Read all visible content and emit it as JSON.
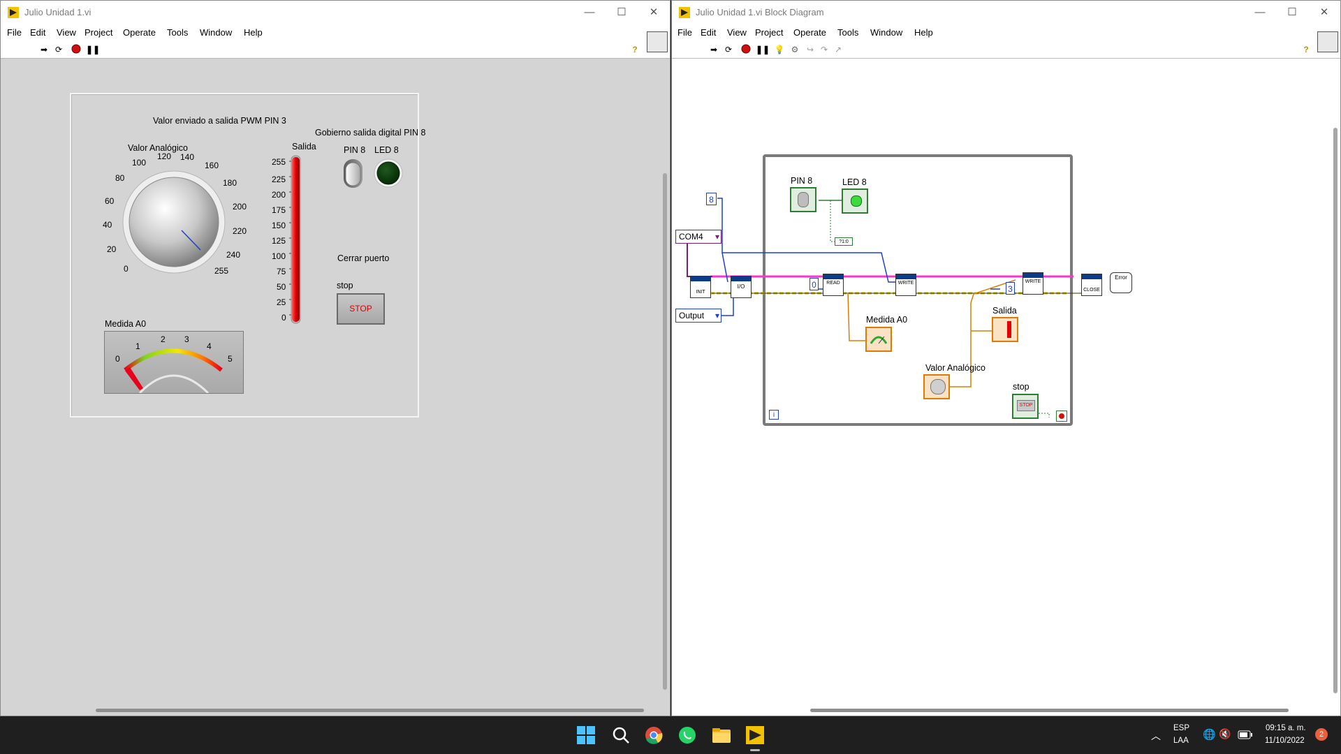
{
  "front_panel": {
    "title": "Julio Unidad 1.vi",
    "menu": [
      "File",
      "Edit",
      "View",
      "Project",
      "Operate",
      "Tools",
      "Window",
      "Help"
    ],
    "pwm_caption": "Valor enviado a salida PWM PIN 3",
    "knob": {
      "label": "Valor Analógico",
      "scale": [
        "0",
        "20",
        "40",
        "60",
        "80",
        "100",
        "120",
        "140",
        "160",
        "180",
        "200",
        "220",
        "240",
        "255"
      ]
    },
    "digital_caption": "Gobierno salida digital PIN 8",
    "switch_label": "PIN 8",
    "led_label": "LED 8",
    "thermo": {
      "label": "Salida",
      "scale": [
        "255",
        "225",
        "200",
        "175",
        "150",
        "125",
        "100",
        "75",
        "50",
        "25",
        "0"
      ],
      "fill_fraction": 1.0
    },
    "close_port_caption": "Cerrar puerto",
    "stop_label": "stop",
    "stop_button_text": "STOP",
    "meter": {
      "label": "Medida A0",
      "scale": [
        "0",
        "1",
        "2",
        "3",
        "4",
        "5"
      ],
      "value": 0
    }
  },
  "block_diagram": {
    "title": "Julio Unidad 1.vi Block Diagram",
    "menu": [
      "File",
      "Edit",
      "View",
      "Project",
      "Operate",
      "Tools",
      "Window",
      "Help"
    ],
    "const_pin8": "8",
    "const_com": "COM4",
    "const_output": "Output",
    "const_zero": "0",
    "const_three": "3",
    "label_pin8": "PIN 8",
    "label_led8": "LED 8",
    "label_medida": "Medida A0",
    "label_salida": "Salida",
    "label_valor": "Valor Analógico",
    "label_stop": "stop",
    "node_init": "INIT",
    "node_io": "I/O",
    "node_read": "READ",
    "node_write1": "WRITE",
    "node_write2": "WRITE",
    "node_close": "CLOSE",
    "node_error": "Error",
    "loop_index": "i",
    "node_tf": "?1:0"
  },
  "taskbar": {
    "lang": "ESP",
    "lang2": "LAA",
    "time": "09:15 a. m.",
    "date": "11/10/2022",
    "notifications": "2"
  },
  "colors": {
    "boolean_green": "#2f7d32",
    "numeric_orange": "#e07b00",
    "cluster_pink": "#ff33cc",
    "error_yellow": "#c8b400",
    "int_blue": "#1f3fd0",
    "refnum_purple": "#7b1f7b"
  }
}
